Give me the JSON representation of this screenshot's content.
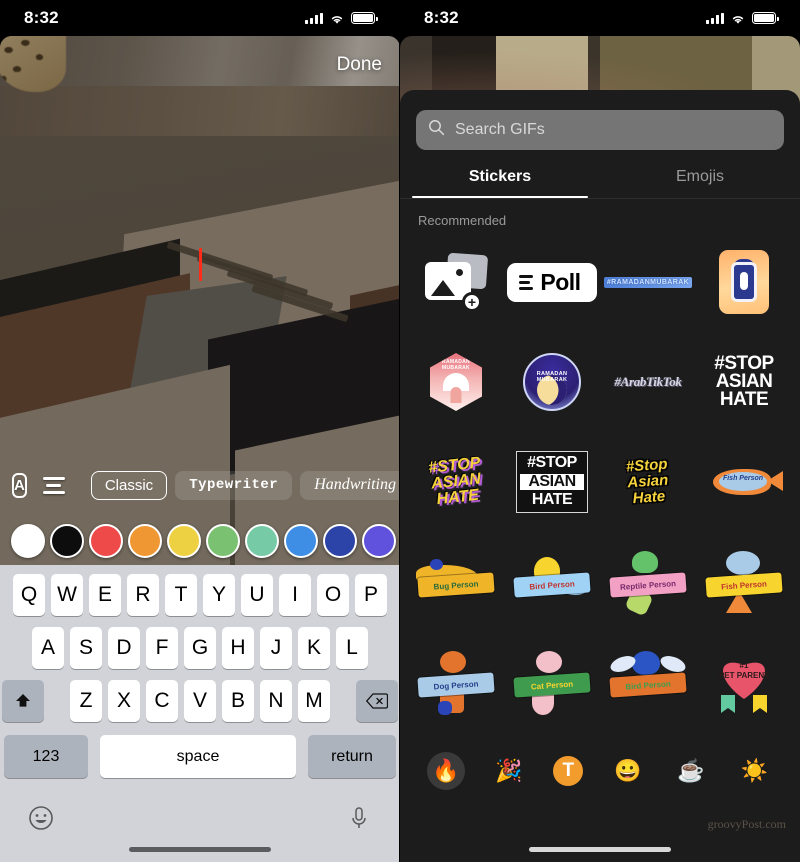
{
  "left_phone": {
    "status": {
      "time": "8:32",
      "signal_icon": "cellular-bars-icon",
      "wifi_icon": "wifi-icon",
      "battery_icon": "battery-icon"
    },
    "done_label": "Done",
    "style_bar": {
      "text_style_icon": "letter-a-in-box-icon",
      "align_icon": "text-align-icon",
      "fonts": [
        {
          "label": "Classic",
          "selected": true
        },
        {
          "label": "Typewriter",
          "selected": false
        },
        {
          "label": "Handwriting",
          "selected": false
        }
      ]
    },
    "colors": [
      {
        "name": "white",
        "hex": "#ffffff",
        "selected": true
      },
      {
        "name": "black",
        "hex": "#0d0d0d",
        "selected": false
      },
      {
        "name": "red",
        "hex": "#ef4a4a",
        "selected": false
      },
      {
        "name": "orange",
        "hex": "#ef9833",
        "selected": false
      },
      {
        "name": "yellow",
        "hex": "#eed143",
        "selected": false
      },
      {
        "name": "green",
        "hex": "#7ac171",
        "selected": false
      },
      {
        "name": "mint",
        "hex": "#76cba6",
        "selected": false
      },
      {
        "name": "light-blue",
        "hex": "#3e8ee6",
        "selected": false
      },
      {
        "name": "dark-blue",
        "hex": "#2c43a8",
        "selected": false
      },
      {
        "name": "purple",
        "hex": "#6152dd",
        "selected": false
      }
    ],
    "keyboard": {
      "row1": [
        "Q",
        "W",
        "E",
        "R",
        "T",
        "Y",
        "U",
        "I",
        "O",
        "P"
      ],
      "row2": [
        "A",
        "S",
        "D",
        "F",
        "G",
        "H",
        "J",
        "K",
        "L"
      ],
      "row3": [
        "Z",
        "X",
        "C",
        "V",
        "B",
        "N",
        "M"
      ],
      "shift_icon": "shift-arrow-icon",
      "backspace_icon": "backspace-icon",
      "numbers_label": "123",
      "space_label": "space",
      "return_label": "return",
      "emoji_icon": "smiley-face-icon",
      "mic_icon": "microphone-icon"
    }
  },
  "right_phone": {
    "status": {
      "time": "8:32",
      "signal_icon": "cellular-bars-icon",
      "wifi_icon": "wifi-icon",
      "battery_icon": "battery-icon"
    },
    "search": {
      "placeholder": "Search GIFs",
      "icon": "search-magnifier-icon"
    },
    "tabs": [
      {
        "label": "Stickers",
        "active": true
      },
      {
        "label": "Emojis",
        "active": false
      }
    ],
    "section_title": "Recommended",
    "stickers": [
      {
        "kind": "photos",
        "name": "add-photo-sticker",
        "text": ""
      },
      {
        "kind": "poll",
        "name": "poll-sticker",
        "text": "Poll"
      },
      {
        "kind": "ramadan-text",
        "name": "ramadan-mubarak-text-sticker",
        "text": "#RAMADANMUBARAK"
      },
      {
        "kind": "lantern",
        "name": "ramadan-lantern-sticker",
        "text": ""
      },
      {
        "kind": "mosque",
        "name": "ramadan-mubarak-mosque-sticker",
        "text": "RAMADAN MUBARAK"
      },
      {
        "kind": "moon",
        "name": "ramadan-mubarak-moon-sticker",
        "text": "RAMADAN MUBARAK"
      },
      {
        "kind": "arabtiktok",
        "name": "arab-tiktok-sticker",
        "text": "#ArabTikTok"
      },
      {
        "kind": "stop-plain",
        "name": "stop-asian-hate-white-sticker",
        "text": "#STOP ASIAN HATE"
      },
      {
        "kind": "stop-yellow",
        "name": "stop-asian-hate-yellow-sticker",
        "text": "#STOP ASIAN HATE"
      },
      {
        "kind": "stop-box",
        "name": "stop-asian-hate-boxed-sticker",
        "text": "#STOP ASIAN HATE"
      },
      {
        "kind": "stop-script",
        "name": "stop-asian-hate-script-sticker",
        "text": "#Stop Asian Hate"
      },
      {
        "kind": "fish-flat",
        "name": "fish-person-flat-sticker",
        "text": "Fish Person"
      },
      {
        "kind": "bug",
        "name": "bug-person-sticker",
        "text": "Bug Person"
      },
      {
        "kind": "bird",
        "name": "bird-person-sticker",
        "text": "Bird Person"
      },
      {
        "kind": "reptile",
        "name": "reptile-person-sticker",
        "text": "Reptile Person"
      },
      {
        "kind": "fish",
        "name": "fish-person-sticker",
        "text": "Fish Person"
      },
      {
        "kind": "dog",
        "name": "dog-person-sticker",
        "text": "Dog Person"
      },
      {
        "kind": "cat",
        "name": "cat-person-sticker",
        "text": "Cat Person"
      },
      {
        "kind": "birdblue",
        "name": "bird-person-blue-sticker",
        "text": "Bird Person"
      },
      {
        "kind": "petparent",
        "name": "pet-parent-ribbon-sticker",
        "text": "#1 PET PARENT"
      }
    ],
    "rail": [
      {
        "icon": "fire-emoji",
        "glyph": "🔥",
        "selected": true
      },
      {
        "icon": "party-popper-emoji",
        "glyph": "🎉",
        "selected": false
      },
      {
        "icon": "text-t-icon",
        "glyph": "T",
        "selected": false
      },
      {
        "icon": "grinning-face-emoji",
        "glyph": "😀",
        "selected": false
      },
      {
        "icon": "hot-beverage-emoji",
        "glyph": "☕",
        "selected": false
      },
      {
        "icon": "sun-emoji",
        "glyph": "☀️",
        "selected": false
      }
    ],
    "watermark": "groovyPost.com"
  }
}
